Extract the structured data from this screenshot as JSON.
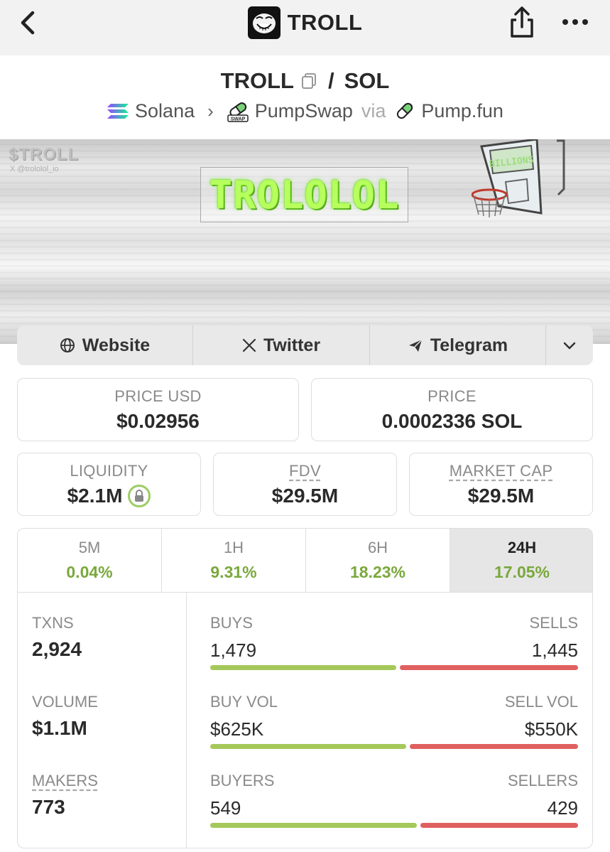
{
  "header": {
    "title": "TROLL"
  },
  "pair": {
    "base": "TROLL",
    "separator": "/",
    "quote": "SOL",
    "chain": "Solana",
    "dex": "PumpSwap",
    "via_label": "via",
    "launchpad": "Pump.fun"
  },
  "banner": {
    "watermark_title": "$TROLL",
    "watermark_handle": "X @trololol_io",
    "headline": "TROLOLOL",
    "hoop_text": "BILLIONS"
  },
  "social": {
    "website": "Website",
    "twitter": "Twitter",
    "telegram": "Telegram"
  },
  "stats": {
    "price_usd_label": "PRICE USD",
    "price_usd": "$0.02956",
    "price_label": "PRICE",
    "price_native": "0.0002336 SOL",
    "liquidity_label": "LIQUIDITY",
    "liquidity": "$2.1M",
    "fdv_label": "FDV",
    "fdv": "$29.5M",
    "mcap_label": "MARKET CAP",
    "mcap": "$29.5M"
  },
  "timeframes": [
    {
      "label": "5M",
      "change": "0.04%"
    },
    {
      "label": "1H",
      "change": "9.31%"
    },
    {
      "label": "6H",
      "change": "18.23%"
    },
    {
      "label": "24H",
      "change": "17.05%"
    }
  ],
  "active_timeframe": "24H",
  "txns": {
    "txns_label": "TXNS",
    "txns": "2,924",
    "volume_label": "VOLUME",
    "volume": "$1.1M",
    "makers_label": "MAKERS",
    "makers": "773",
    "buys_label": "BUYS",
    "buys": "1,479",
    "sells_label": "SELLS",
    "sells": "1,445",
    "buy_vol_label": "BUY VOL",
    "buy_vol": "$625K",
    "sell_vol_label": "SELL VOL",
    "sell_vol": "$550K",
    "buyers_label": "BUYERS",
    "buyers": "549",
    "sellers_label": "SELLERS",
    "sellers": "429"
  },
  "ratios": {
    "buys_fraction": 0.506,
    "buy_vol_fraction": 0.532,
    "buyers_fraction": 0.561
  },
  "colors": {
    "positive": "#7aa83c",
    "buy_bar": "#a5c85a",
    "sell_bar": "#e06060",
    "headline_glow": "#b6ff5c"
  }
}
